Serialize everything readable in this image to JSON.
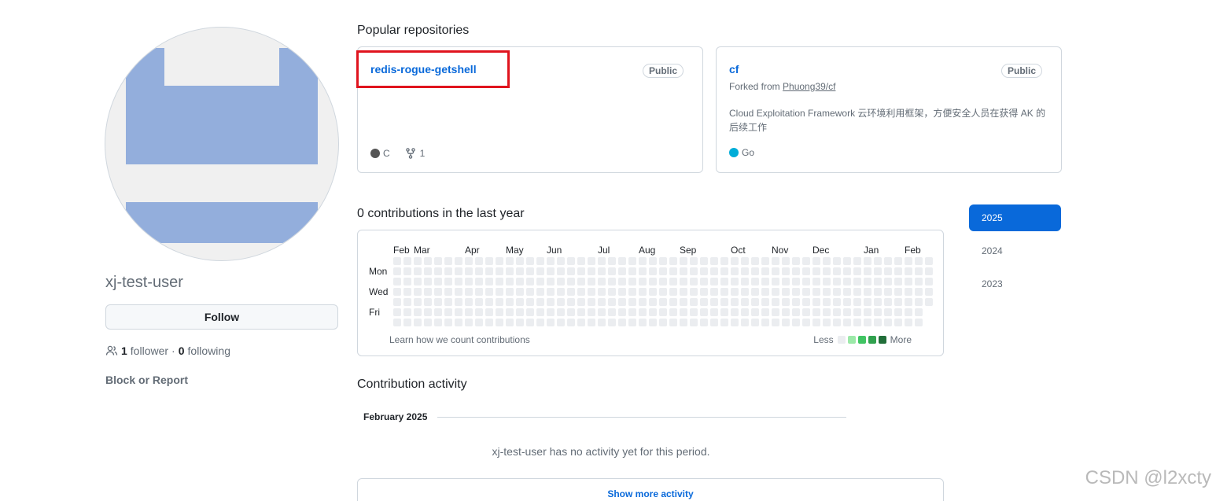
{
  "profile": {
    "username": "xj-test-user",
    "follow_label": "Follow",
    "followers_count": "1",
    "followers_label": "follower",
    "separator": "·",
    "following_count": "0",
    "following_label": "following",
    "block_report_label": "Block or Report"
  },
  "popular": {
    "title": "Popular repositories",
    "repos": [
      {
        "name": "redis-rogue-getshell",
        "visibility": "Public",
        "language": "C",
        "language_color": "#555555",
        "forks": "1"
      },
      {
        "name": "cf",
        "visibility": "Public",
        "forked_prefix": "Forked from",
        "forked_from": "Phuong39/cf",
        "description": "Cloud Exploitation Framework 云环境利用框架，方便安全人员在获得 AK 的后续工作",
        "language": "Go",
        "language_color": "#00ADD8"
      }
    ]
  },
  "contributions": {
    "title": "0 contributions in the last year",
    "months": [
      "Feb",
      "Mar",
      "Apr",
      "May",
      "Jun",
      "Jul",
      "Aug",
      "Sep",
      "Oct",
      "Nov",
      "Dec",
      "Jan",
      "Feb"
    ],
    "days": [
      "Mon",
      "Wed",
      "Fri"
    ],
    "learn_label": "Learn how we count contributions",
    "less_label": "Less",
    "more_label": "More",
    "legend_colors": [
      "#ebedf0",
      "#9be9a8",
      "#40c463",
      "#30a14e",
      "#216e39"
    ]
  },
  "years": [
    "2025",
    "2024",
    "2023"
  ],
  "active_year": "2025",
  "activity": {
    "title": "Contribution activity",
    "period": "February 2025",
    "empty_message": "xj-test-user has no activity yet for this period.",
    "show_more_label": "Show more activity"
  },
  "watermark": "CSDN @l2xcty"
}
